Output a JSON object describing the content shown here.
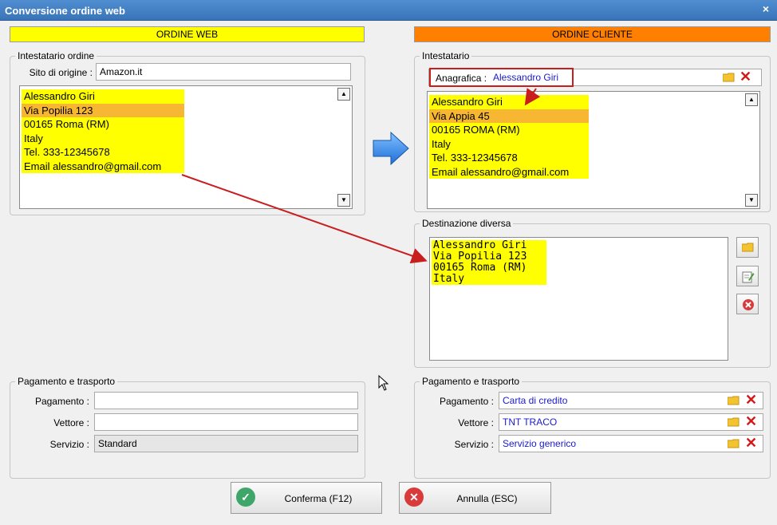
{
  "window": {
    "title": "Conversione ordine web",
    "close_glyph": "×"
  },
  "left": {
    "banner": "ORDINE WEB",
    "holder": {
      "legend": "Intestatario ordine",
      "site_label": "Sito di origine :",
      "site_value": "Amazon.it",
      "lines": [
        "Alessandro Giri",
        "Via Popilia 123",
        "00165 Roma (RM)",
        "Italy",
        "Tel. 333-12345678",
        "Email alessandro@gmail.com"
      ]
    },
    "payment": {
      "legend": "Pagamento e trasporto",
      "pagamento_label": "Pagamento :",
      "pagamento_value": "",
      "vettore_label": "Vettore :",
      "vettore_value": "",
      "servizio_label": "Servizio :",
      "servizio_value": "Standard"
    }
  },
  "right": {
    "banner": "ORDINE CLIENTE",
    "holder": {
      "legend": "Intestatario",
      "anagrafica_label": "Anagrafica :",
      "anagrafica_value": "Alessandro Giri",
      "lines": [
        "Alessandro Giri",
        "Via Appia 45",
        "00165 ROMA (RM)",
        "Italy",
        "Tel. 333-12345678",
        "Email alessandro@gmail.com"
      ]
    },
    "destination": {
      "legend": "Destinazione diversa",
      "lines": [
        "Alessandro Giri",
        "Via Popilia 123",
        "00165 Roma (RM)",
        "Italy"
      ]
    },
    "payment": {
      "legend": "Pagamento e trasporto",
      "pagamento_label": "Pagamento :",
      "pagamento_value": "Carta di credito",
      "vettore_label": "Vettore :",
      "vettore_value": "TNT TRACO",
      "servizio_label": "Servizio :",
      "servizio_value": "Servizio generico"
    }
  },
  "buttons": {
    "confirm": "Conferma (F12)",
    "cancel": "Annulla (ESC)"
  },
  "colors": {
    "banner_left": "#ffff00",
    "banner_right": "#ff8000",
    "highlight": "#ffff00",
    "selected": "#f7b733",
    "arrow": "#c81e1e",
    "confirm_icon": "#3fa66a",
    "cancel_icon": "#d93b3b"
  },
  "icons": [
    "close-icon",
    "scroll-up-icon",
    "scroll-down-icon",
    "blue-arrow-icon",
    "folder-icon",
    "clear-icon",
    "edit-icon",
    "delete-icon",
    "check-icon",
    "cancel-icon",
    "mouse-cursor-icon"
  ]
}
